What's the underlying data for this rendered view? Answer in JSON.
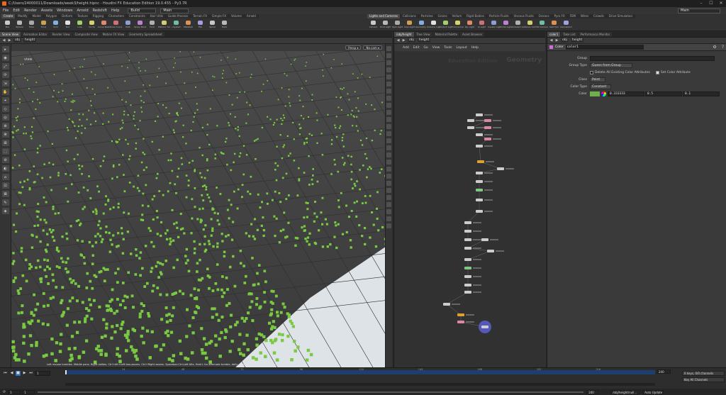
{
  "window": {
    "title": "C:/Users/24000011/Downloads/week3/height.hipnc - Houdini FX Education Edition 19.0.455 - Py3.7R",
    "controls": [
      "–",
      "☐",
      "✕"
    ]
  },
  "menubar": {
    "items": [
      "File",
      "Edit",
      "Render",
      "Assets",
      "Windows",
      "Arnold",
      "Redshift",
      "Help"
    ],
    "build_label": "Build",
    "desktop_label": "Main",
    "right_desktop": "Main"
  },
  "shelf_left": {
    "tabs": [
      "Create",
      "Modify",
      "Model",
      "Polygon",
      "Deform",
      "Texture",
      "Rigging",
      "Characters",
      "Constraints",
      "Hair Utils",
      "Guide Process",
      "Terrain FX",
      "Simple FX",
      "Volume",
      "Arnold"
    ],
    "tools": [
      "Box",
      "Sphere",
      "Tube",
      "Torus",
      "Grid",
      "Null",
      "Line",
      "Circle",
      "Curve Bezier",
      "Draw Curve",
      "Path",
      "Spray Paint",
      "Font",
      "Platonic Solids",
      "L-System",
      "Metaball",
      "File",
      "Spiral",
      "Helix"
    ]
  },
  "shelf_right": {
    "tabs": [
      "Lights and Cameras",
      "Collisions",
      "Particles",
      "Grains",
      "Vellum",
      "Rigid Bodies",
      "Particle Fluids",
      "Viscous Fluids",
      "Oceans",
      "Pyro FX",
      "FEM",
      "Wires",
      "Crowds",
      "Drive Simulation"
    ],
    "tools": [
      "Camera",
      "Point Light",
      "Spot Light",
      "Area Light",
      "Geometry Light",
      "Volume Light",
      "Distant Light",
      "Environment Light",
      "Sky Light",
      "GI Light",
      "Caustic Light",
      "Portal Light",
      "Ambient Light",
      "Stereo Camera",
      "VR Camera",
      "Switcher",
      "Gamepad Camera"
    ]
  },
  "viewport": {
    "tabs": [
      "Scene View",
      "Animation Editor",
      "Render View",
      "Composite View",
      "Motion FX View",
      "Geometry Spreadsheet"
    ],
    "path": [
      "obj",
      "height"
    ],
    "view_name": "view",
    "persp_label": "Persp ▾",
    "cam_label": "No cam ▾",
    "status": "Left mouse tumbles. Middle pans. Right dollies. Ctrl+Alt+Left box-zooms. Ctrl+Right zooms. Spacebar-Ctrl-Left tilts. Hold L for alternate tumble, dolly, and zoom. M or Alt+M for First Person Navigation.",
    "left_tools": [
      "▸",
      "◉",
      "⤢",
      "⟳",
      "⇲",
      "✋",
      "⌖",
      "◇",
      "◎",
      "⊕",
      "⊗",
      "⊞",
      "⬚",
      "⊘",
      "◐",
      "⌂",
      "⊡",
      "⊠",
      "✎",
      "◈"
    ]
  },
  "network": {
    "tabs": [
      "/obj/height",
      "Tree View",
      "Material Palette",
      "Asset Browser"
    ],
    "path": [
      "obj",
      "height"
    ],
    "menu": [
      "Add",
      "Edit",
      "Go",
      "View",
      "Tools",
      "Layout",
      "Help"
    ],
    "watermark_edu": "Education Edition",
    "watermark_ctx": "Geometry"
  },
  "parms": {
    "tabs": [
      "color1",
      "Take List",
      "Performance Monitor"
    ],
    "path": [
      "obj",
      "height"
    ],
    "node_type": "Color",
    "node_name": "color1",
    "group_label": "Group",
    "group_value": "",
    "group_type_label": "Group Type",
    "group_type_value": "Guess from Group",
    "delete_attrs_label": "Delete All Existing Color Attributes",
    "set_color_attr_label": "Set Color Attribute",
    "class_label": "Class",
    "class_value": "Point",
    "color_type_label": "Color Type",
    "color_type_value": "Constant",
    "color_label": "Color",
    "color_r": "0.333333",
    "color_g": "0.5",
    "color_b": "0.1",
    "swatch": "#6fb04a"
  },
  "timeline": {
    "ticks": [
      "24",
      "48",
      "72",
      "96",
      "120",
      "144",
      "168",
      "192",
      "216"
    ],
    "current_frame": "1",
    "start": "1",
    "start2": "1",
    "end": "240",
    "end2": "240",
    "keys_label": "0 keys, 0/0 channels",
    "key_all_label": "Key All Channels",
    "auto_update": "Auto Update",
    "path_field": "/obj/height/null..."
  },
  "colors": {
    "accent_blue": "#2f6fbf",
    "points_green": "#7ac943",
    "node_selected": "#5a5fd1"
  }
}
